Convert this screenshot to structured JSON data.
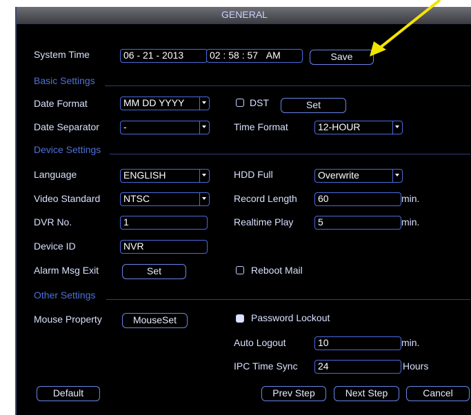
{
  "title": "GENERAL",
  "system_time": {
    "label": "System Time",
    "date": "06 - 21 - 2013",
    "time": "02 : 58 : 57",
    "ampm": "AM",
    "save": "Save"
  },
  "basic": {
    "heading": "Basic Settings",
    "date_format_label": "Date Format",
    "date_format_value": "MM DD YYYY",
    "dst_label": "DST",
    "dst_set": "Set",
    "separator_label": "Date Separator",
    "separator_value": "-",
    "time_format_label": "Time Format",
    "time_format_value": "12-HOUR"
  },
  "device": {
    "heading": "Device Settings",
    "language_label": "Language",
    "language_value": "ENGLISH",
    "hdd_label": "HDD Full",
    "hdd_value": "Overwrite",
    "video_label": "Video Standard",
    "video_value": "NTSC",
    "record_label": "Record Length",
    "record_value": "60",
    "record_unit": "min.",
    "dvr_label": "DVR No.",
    "dvr_value": "1",
    "realtime_label": "Realtime Play",
    "realtime_value": "5",
    "realtime_unit": "min.",
    "device_id_label": "Device ID",
    "device_id_value": "NVR",
    "alarm_label": "Alarm Msg Exit",
    "alarm_set": "Set",
    "reboot_label": "Reboot Mail"
  },
  "other": {
    "heading": "Other Settings",
    "mouse_label": "Mouse Property",
    "mouse_btn": "MouseSet",
    "password_label": "Password Lockout",
    "autologout_label": "Auto Logout",
    "autologout_value": "10",
    "autologout_unit": "min.",
    "ipc_label": "IPC Time Sync",
    "ipc_value": "24",
    "ipc_unit": "Hours"
  },
  "footer": {
    "default": "Default",
    "prev": "Prev Step",
    "next": "Next Step",
    "cancel": "Cancel"
  },
  "colors": {
    "accent": "#4d6be0",
    "section": "#4f72d6",
    "annotation": "#f2e400"
  }
}
